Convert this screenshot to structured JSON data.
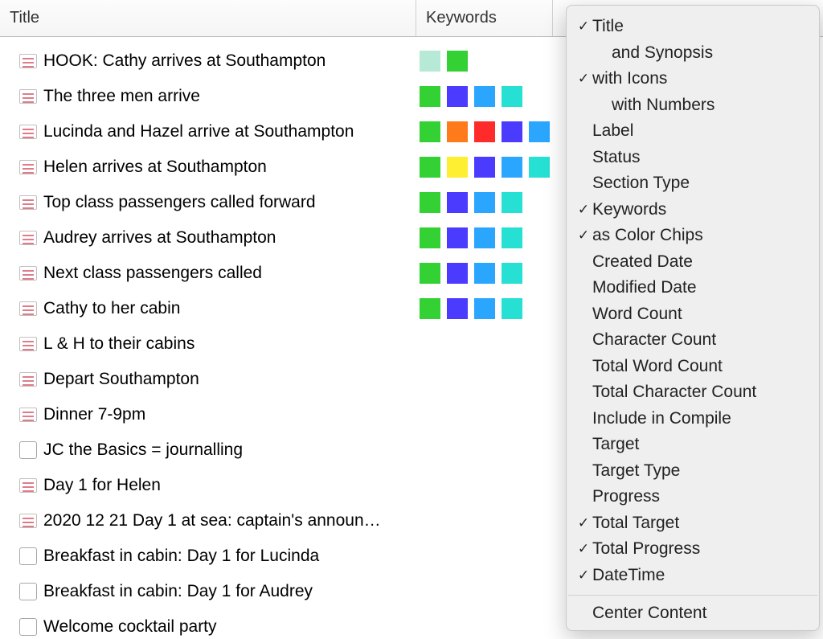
{
  "columns": {
    "title": "Title",
    "keywords": "Keywords"
  },
  "chip_colors": {
    "mint": "#b6e9d6",
    "green": "#33d133",
    "orange": "#ff7a1a",
    "red": "#ff2a2a",
    "blue": "#4b3bff",
    "sky": "#2aa6ff",
    "cyan": "#27e0d4",
    "yellow": "#ffef33"
  },
  "documents": [
    {
      "icon": "doc",
      "title": "HOOK: Cathy arrives at Southampton",
      "chips": [
        "mint",
        "green"
      ]
    },
    {
      "icon": "doc",
      "title": "The three men arrive",
      "chips": [
        "green",
        "blue",
        "sky",
        "cyan"
      ]
    },
    {
      "icon": "doc",
      "title": "Lucinda and Hazel arrive at Southampton",
      "chips": [
        "green",
        "orange",
        "red",
        "blue",
        "sky"
      ]
    },
    {
      "icon": "doc",
      "title": "Helen arrives at Southampton",
      "chips": [
        "green",
        "yellow",
        "blue",
        "sky",
        "cyan"
      ]
    },
    {
      "icon": "doc",
      "title": "Top class passengers called forward",
      "chips": [
        "green",
        "blue",
        "sky",
        "cyan"
      ]
    },
    {
      "icon": "doc",
      "title": "Audrey arrives at Southampton",
      "chips": [
        "green",
        "blue",
        "sky",
        "cyan"
      ]
    },
    {
      "icon": "doc",
      "title": "Next class passengers called",
      "chips": [
        "green",
        "blue",
        "sky",
        "cyan"
      ]
    },
    {
      "icon": "doc",
      "title": "Cathy to her cabin",
      "chips": [
        "green",
        "blue",
        "sky",
        "cyan"
      ]
    },
    {
      "icon": "doc",
      "title": "L & H to their cabins",
      "chips": []
    },
    {
      "icon": "doc",
      "title": "Depart Southampton",
      "chips": []
    },
    {
      "icon": "doc",
      "title": "Dinner 7-9pm",
      "chips": []
    },
    {
      "icon": "blank",
      "title": "JC the Basics = journalling",
      "chips": []
    },
    {
      "icon": "doc",
      "title": " Day 1 for Helen",
      "chips": []
    },
    {
      "icon": "doc",
      "title": "2020 12 21 Day 1 at sea: captain's announ…",
      "chips": []
    },
    {
      "icon": "blank",
      "title": "Breakfast in cabin: Day 1 for Lucinda",
      "chips": []
    },
    {
      "icon": "blank",
      "title": "Breakfast in cabin: Day 1 for Audrey",
      "chips": []
    },
    {
      "icon": "blank",
      "title": "Welcome cocktail party",
      "chips": []
    }
  ],
  "menu": [
    {
      "label": "Title",
      "checked": true,
      "indent": false
    },
    {
      "label": "and Synopsis",
      "checked": false,
      "indent": true
    },
    {
      "label": "with Icons",
      "checked": true,
      "indent": false
    },
    {
      "label": "with Numbers",
      "checked": false,
      "indent": true
    },
    {
      "label": "Label",
      "checked": false,
      "indent": false
    },
    {
      "label": "Status",
      "checked": false,
      "indent": false
    },
    {
      "label": "Section Type",
      "checked": false,
      "indent": false
    },
    {
      "label": "Keywords",
      "checked": true,
      "indent": false
    },
    {
      "label": "as Color Chips",
      "checked": true,
      "indent": false
    },
    {
      "label": "Created Date",
      "checked": false,
      "indent": false
    },
    {
      "label": "Modified Date",
      "checked": false,
      "indent": false
    },
    {
      "label": "Word Count",
      "checked": false,
      "indent": false
    },
    {
      "label": "Character Count",
      "checked": false,
      "indent": false
    },
    {
      "label": "Total Word Count",
      "checked": false,
      "indent": false
    },
    {
      "label": "Total Character Count",
      "checked": false,
      "indent": false
    },
    {
      "label": "Include in Compile",
      "checked": false,
      "indent": false
    },
    {
      "label": "Target",
      "checked": false,
      "indent": false
    },
    {
      "label": "Target Type",
      "checked": false,
      "indent": false
    },
    {
      "label": "Progress",
      "checked": false,
      "indent": false
    },
    {
      "label": "Total Target",
      "checked": true,
      "indent": false
    },
    {
      "label": "Total Progress",
      "checked": true,
      "indent": false
    },
    {
      "label": "DateTime",
      "checked": true,
      "indent": false
    },
    {
      "separator": true
    },
    {
      "label": "Center Content",
      "checked": false,
      "indent": false
    }
  ]
}
